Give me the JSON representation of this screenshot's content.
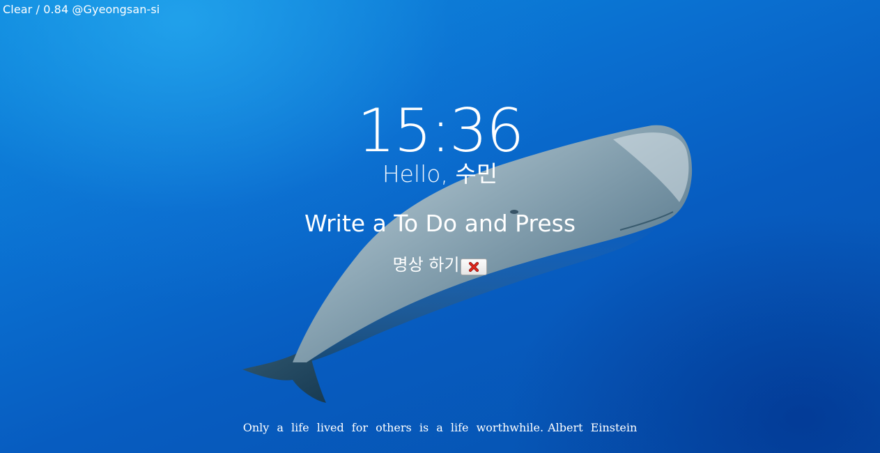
{
  "weather": {
    "text": "Clear / 0.84 @Gyeongsan-si"
  },
  "clock": {
    "time": "15:36"
  },
  "greeting": {
    "hello": "Hello, ",
    "user": "수민"
  },
  "todo": {
    "prompt": "Write a To Do and Press",
    "items": [
      {
        "text": "명상 하기"
      }
    ]
  },
  "quote": {
    "text": "Only a life lived for others is a life worthwhile.",
    "author": "Albert Einstein"
  },
  "colors": {
    "background": "#0a6fd0",
    "text": "#ffffff",
    "delete_icon": "#d0201a"
  },
  "icons": {
    "delete": "close-x-icon",
    "background": "sperm-whale-photo"
  }
}
